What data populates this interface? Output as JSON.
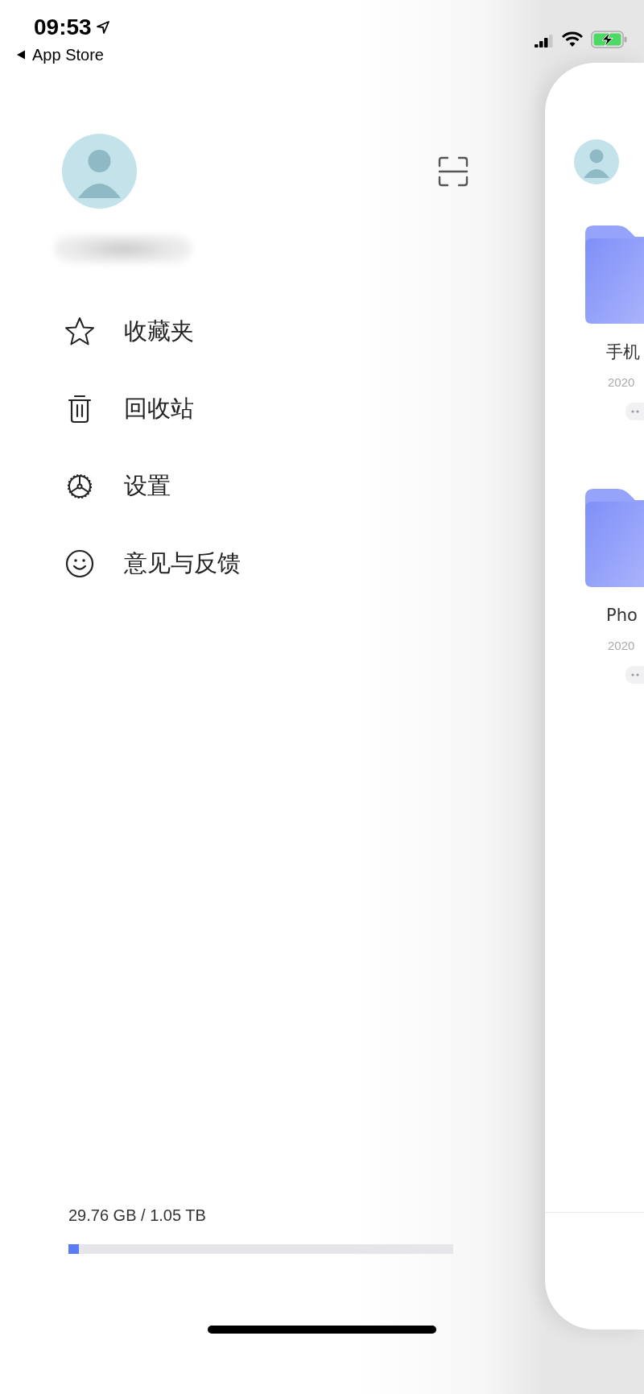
{
  "status_bar": {
    "time": "09:53",
    "back_label": "App Store"
  },
  "menu": [
    {
      "kind": "star",
      "label": "收藏夹"
    },
    {
      "kind": "trash",
      "label": "回收站"
    },
    {
      "kind": "gear",
      "label": "设置"
    },
    {
      "kind": "smile",
      "label": "意见与反馈"
    }
  ],
  "storage": {
    "text": "29.76 GB / 1.05 TB",
    "level": 0.028
  },
  "files": [
    {
      "name": "手机",
      "date": "2020"
    },
    {
      "name": "Pho",
      "date": "2020"
    }
  ]
}
